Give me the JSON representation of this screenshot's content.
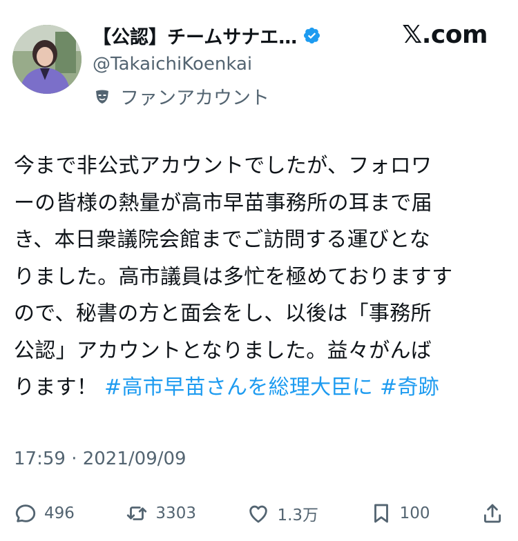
{
  "header": {
    "display_name": "【公認】チームサナエ…",
    "handle": "@TakaichiKoenkai",
    "fan_label": "ファンアカウント",
    "brand": "𝕏.com",
    "verified_color": "#1d9bf0"
  },
  "tweet": {
    "lines": [
      "今まで非公式アカウントでしたが、フォロワ",
      "ーの皆様の熱量が高市早苗事務所の耳まで届",
      "き、本日衆議院会館までご訪問する運びとな",
      "りました。高市議員は多忙を極めておりますす",
      "ので、秘書の方と面会をし、以後は「事務所",
      "公認」アカウントとなりました。益々がんば"
    ],
    "last_line_text": "ります！ ",
    "hashtag_1": "#高市早苗さんを総理大臣に",
    "hashtag_2": "#奇跡",
    "hashtag_color": "#1d9bf0"
  },
  "timestamp": "17:59 · 2021/09/09",
  "actions": {
    "replies": "496",
    "retweets": "3303",
    "likes": "1.3万",
    "bookmarks": "100"
  },
  "icons": [
    "avatar",
    "verified-badge-icon",
    "fan-mask-icon",
    "reply-icon",
    "retweet-icon",
    "like-icon",
    "bookmark-icon",
    "share-icon"
  ]
}
